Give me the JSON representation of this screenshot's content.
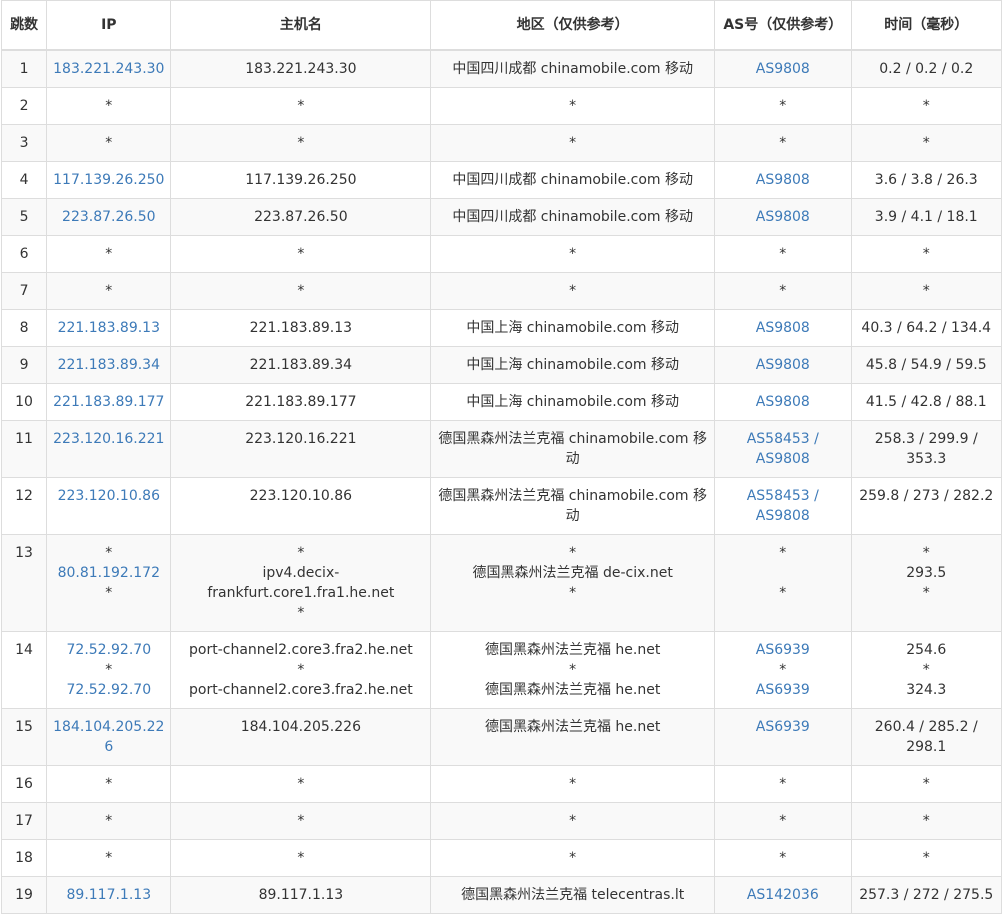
{
  "headers": {
    "hop": "跳数",
    "ip": "IP",
    "host": "主机名",
    "region": "地区（仅供参考）",
    "as": "AS号（仅供参考）",
    "time": "时间（毫秒）"
  },
  "rows": [
    {
      "hop": "1",
      "ip": [
        "183.221.243.30"
      ],
      "host": [
        "183.221.243.30"
      ],
      "region": [
        "中国四川成都 chinamobile.com 移动"
      ],
      "as": [
        "AS9808"
      ],
      "time": [
        "0.2 / 0.2 / 0.2"
      ]
    },
    {
      "hop": "2",
      "ip": [
        "*"
      ],
      "host": [
        "*"
      ],
      "region": [
        "*"
      ],
      "as": [
        "*"
      ],
      "time": [
        "*"
      ]
    },
    {
      "hop": "3",
      "ip": [
        "*"
      ],
      "host": [
        "*"
      ],
      "region": [
        "*"
      ],
      "as": [
        "*"
      ],
      "time": [
        "*"
      ]
    },
    {
      "hop": "4",
      "ip": [
        "117.139.26.250"
      ],
      "host": [
        "117.139.26.250"
      ],
      "region": [
        "中国四川成都 chinamobile.com 移动"
      ],
      "as": [
        "AS9808"
      ],
      "time": [
        "3.6 / 3.8 / 26.3"
      ]
    },
    {
      "hop": "5",
      "ip": [
        "223.87.26.50"
      ],
      "host": [
        "223.87.26.50"
      ],
      "region": [
        "中国四川成都 chinamobile.com 移动"
      ],
      "as": [
        "AS9808"
      ],
      "time": [
        "3.9 / 4.1 / 18.1"
      ]
    },
    {
      "hop": "6",
      "ip": [
        "*"
      ],
      "host": [
        "*"
      ],
      "region": [
        "*"
      ],
      "as": [
        "*"
      ],
      "time": [
        "*"
      ]
    },
    {
      "hop": "7",
      "ip": [
        "*"
      ],
      "host": [
        "*"
      ],
      "region": [
        "*"
      ],
      "as": [
        "*"
      ],
      "time": [
        "*"
      ]
    },
    {
      "hop": "8",
      "ip": [
        "221.183.89.13"
      ],
      "host": [
        "221.183.89.13"
      ],
      "region": [
        "中国上海 chinamobile.com 移动"
      ],
      "as": [
        "AS9808"
      ],
      "time": [
        "40.3 / 64.2 / 134.4"
      ]
    },
    {
      "hop": "9",
      "ip": [
        "221.183.89.34"
      ],
      "host": [
        "221.183.89.34"
      ],
      "region": [
        "中国上海 chinamobile.com 移动"
      ],
      "as": [
        "AS9808"
      ],
      "time": [
        "45.8 / 54.9 / 59.5"
      ]
    },
    {
      "hop": "10",
      "ip": [
        "221.183.89.177"
      ],
      "host": [
        "221.183.89.177"
      ],
      "region": [
        "中国上海 chinamobile.com 移动"
      ],
      "as": [
        "AS9808"
      ],
      "time": [
        "41.5 / 42.8 / 88.1"
      ]
    },
    {
      "hop": "11",
      "ip": [
        "223.120.16.221"
      ],
      "host": [
        "223.120.16.221"
      ],
      "region": [
        "德国黑森州法兰克福 chinamobile.com 移动"
      ],
      "as": [
        "AS58453 / AS9808"
      ],
      "time": [
        "258.3 / 299.9 / 353.3"
      ]
    },
    {
      "hop": "12",
      "ip": [
        "223.120.10.86"
      ],
      "host": [
        "223.120.10.86"
      ],
      "region": [
        "德国黑森州法兰克福 chinamobile.com 移动"
      ],
      "as": [
        "AS58453 / AS9808"
      ],
      "time": [
        "259.8 / 273 / 282.2"
      ]
    },
    {
      "hop": "13",
      "ip": [
        "*",
        "80.81.192.172",
        "*"
      ],
      "host": [
        "*",
        "ipv4.decix-frankfurt.core1.fra1.he.net",
        "*"
      ],
      "region": [
        "*",
        "德国黑森州法兰克福 de-cix.net",
        "*"
      ],
      "as": [
        "*",
        "",
        "*"
      ],
      "time": [
        "*",
        "293.5",
        "*"
      ]
    },
    {
      "hop": "14",
      "ip": [
        "72.52.92.70",
        "*",
        "72.52.92.70"
      ],
      "host": [
        "port-channel2.core3.fra2.he.net",
        "*",
        "port-channel2.core3.fra2.he.net"
      ],
      "region": [
        "德国黑森州法兰克福 he.net",
        "*",
        "德国黑森州法兰克福 he.net"
      ],
      "as": [
        "AS6939",
        "*",
        "AS6939"
      ],
      "time": [
        "254.6",
        "*",
        "324.3"
      ]
    },
    {
      "hop": "15",
      "ip": [
        "184.104.205.226"
      ],
      "host": [
        "184.104.205.226"
      ],
      "region": [
        "德国黑森州法兰克福 he.net"
      ],
      "as": [
        "AS6939"
      ],
      "time": [
        "260.4 / 285.2 / 298.1"
      ]
    },
    {
      "hop": "16",
      "ip": [
        "*"
      ],
      "host": [
        "*"
      ],
      "region": [
        "*"
      ],
      "as": [
        "*"
      ],
      "time": [
        "*"
      ]
    },
    {
      "hop": "17",
      "ip": [
        "*"
      ],
      "host": [
        "*"
      ],
      "region": [
        "*"
      ],
      "as": [
        "*"
      ],
      "time": [
        "*"
      ]
    },
    {
      "hop": "18",
      "ip": [
        "*"
      ],
      "host": [
        "*"
      ],
      "region": [
        "*"
      ],
      "as": [
        "*"
      ],
      "time": [
        "*"
      ]
    },
    {
      "hop": "19",
      "ip": [
        "89.117.1.13"
      ],
      "host": [
        "89.117.1.13"
      ],
      "region": [
        "德国黑森州法兰克福 telecentras.lt"
      ],
      "as": [
        "AS142036"
      ],
      "time": [
        "257.3 / 272 / 275.5"
      ]
    }
  ],
  "colors": {
    "link": "#3d7ab8",
    "border": "#dddddd",
    "row_alt": "#f9f9f9"
  }
}
